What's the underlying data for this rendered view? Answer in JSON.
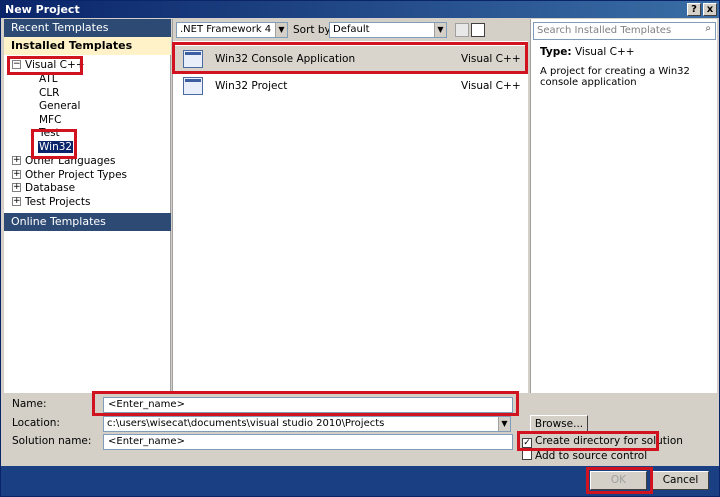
{
  "window": {
    "title": "New Project",
    "help_btn": "?",
    "close_btn": "x"
  },
  "left": {
    "recent_templates": "Recent Templates",
    "installed_templates": "Installed Templates",
    "tree": [
      {
        "label": "Visual C++",
        "expander": "−"
      },
      {
        "label": "ATL"
      },
      {
        "label": "CLR"
      },
      {
        "label": "General"
      },
      {
        "label": "MFC"
      },
      {
        "label": "Test"
      },
      {
        "label": "Win32"
      },
      {
        "label": "Other Languages",
        "expander": "+"
      },
      {
        "label": "Other Project Types",
        "expander": "+"
      },
      {
        "label": "Database",
        "expander": "+"
      },
      {
        "label": "Test Projects",
        "expander": "+"
      }
    ],
    "online_templates": "Online Templates"
  },
  "toolbar": {
    "framework": ".NET Framework 4",
    "sort_label": "Sort by:",
    "sort_value": "Default"
  },
  "templates": [
    {
      "name": "Win32 Console Application",
      "lang": "Visual C++"
    },
    {
      "name": "Win32 Project",
      "lang": "Visual C++"
    }
  ],
  "search": {
    "placeholder": "Search Installed Templates"
  },
  "details": {
    "type_label": "Type:",
    "type_value": "Visual C++",
    "description": "A project for creating a Win32 console application"
  },
  "form": {
    "name_label": "Name:",
    "name_value": "<Enter_name>",
    "location_label": "Location:",
    "location_value": "c:\\users\\wisecat\\documents\\visual studio 2010\\Projects",
    "solution_label": "Solution name:",
    "solution_value": "<Enter_name>",
    "browse": "Browse...",
    "create_dir": "Create directory for solution",
    "create_dir_checked": "✓",
    "add_source": "Add to source control",
    "ok": "OK",
    "cancel": "Cancel"
  },
  "colors": {
    "highlight": "#d0131f",
    "selection": "#0a246a",
    "header": "#2d4a75"
  }
}
